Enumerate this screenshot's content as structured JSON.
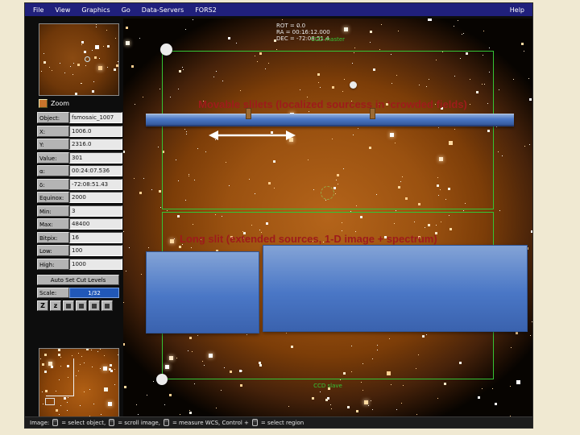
{
  "menu": {
    "items": [
      "File",
      "View",
      "Graphics",
      "Go",
      "Data-Servers",
      "FORS2"
    ],
    "help": "Help"
  },
  "info": {
    "rot": "ROT = 0.0",
    "ra": "RA = 00:16:12.000",
    "dec": "DEC = -72:08:51.4"
  },
  "panel": {
    "zoom_label": "Zoom",
    "fields": [
      {
        "label": "Object:",
        "value": "fsmosaic_1007"
      },
      {
        "label": "X:",
        "value": "1006.0"
      },
      {
        "label": "Y:",
        "value": "2316.0"
      },
      {
        "label": "Value:",
        "value": "301"
      },
      {
        "label": "α:",
        "value": "00:24:07.536"
      },
      {
        "label": "δ:",
        "value": "-72:08:51.43"
      },
      {
        "label": "Equinox:",
        "value": "2000"
      },
      {
        "label": "Min:",
        "value": "3"
      },
      {
        "label": "Max:",
        "value": "48400"
      },
      {
        "label": "Bitpix:",
        "value": "16"
      },
      {
        "label": "Low:",
        "value": "100"
      },
      {
        "label": "High:",
        "value": "1000"
      }
    ],
    "auto_cut_button": "Auto Set Cut Levels",
    "scale_label": "Scale:",
    "scale_value": "1/32",
    "zoom_in_button": "Z",
    "zoom_out_button": "z"
  },
  "image": {
    "ccd_master": "CCD master",
    "ccd_slave": "CCD slave"
  },
  "annotations": {
    "line1": "Movable slilets (localized sourcess in ‘crowded fields)",
    "line2": "Long slit (extended sources, 1-D image + spectrum)",
    "colors": {
      "slit_blue": "#4a77c6",
      "caption_red": "#9e1b1b",
      "ccd_green": "#35c435"
    }
  },
  "statusbar": {
    "segments": [
      "Image:",
      "= select object,",
      "= scroll image,",
      "= measure WCS,  Control +",
      "= select region"
    ]
  }
}
